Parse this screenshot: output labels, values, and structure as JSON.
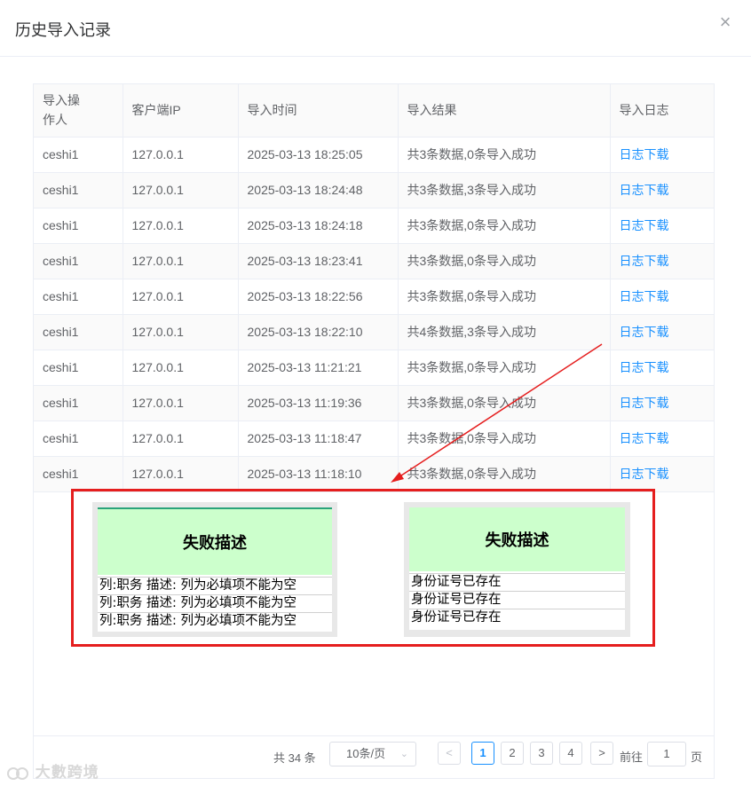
{
  "dialog": {
    "title": "历史导入记录",
    "close_glyph": "×"
  },
  "table": {
    "headers": [
      "导入操作人",
      "客户端IP",
      "导入时间",
      "导入结果",
      "导入日志"
    ],
    "rows": [
      {
        "operator": "ceshi1",
        "ip": "127.0.0.1",
        "time": "2025-03-13 18:25:05",
        "result": "共3条数据,0条导入成功",
        "log": "日志下载"
      },
      {
        "operator": "ceshi1",
        "ip": "127.0.0.1",
        "time": "2025-03-13 18:24:48",
        "result": "共3条数据,3条导入成功",
        "log": "日志下载"
      },
      {
        "operator": "ceshi1",
        "ip": "127.0.0.1",
        "time": "2025-03-13 18:24:18",
        "result": "共3条数据,0条导入成功",
        "log": "日志下载"
      },
      {
        "operator": "ceshi1",
        "ip": "127.0.0.1",
        "time": "2025-03-13 18:23:41",
        "result": "共3条数据,0条导入成功",
        "log": "日志下载"
      },
      {
        "operator": "ceshi1",
        "ip": "127.0.0.1",
        "time": "2025-03-13 18:22:56",
        "result": "共3条数据,0条导入成功",
        "log": "日志下载"
      },
      {
        "operator": "ceshi1",
        "ip": "127.0.0.1",
        "time": "2025-03-13 18:22:10",
        "result": "共4条数据,3条导入成功",
        "log": "日志下载"
      },
      {
        "operator": "ceshi1",
        "ip": "127.0.0.1",
        "time": "2025-03-13 11:21:21",
        "result": "共3条数据,0条导入成功",
        "log": "日志下载"
      },
      {
        "operator": "ceshi1",
        "ip": "127.0.0.1",
        "time": "2025-03-13 11:19:36",
        "result": "共3条数据,0条导入成功",
        "log": "日志下载"
      },
      {
        "operator": "ceshi1",
        "ip": "127.0.0.1",
        "time": "2025-03-13 11:18:47",
        "result": "共3条数据,0条导入成功",
        "log": "日志下载"
      },
      {
        "operator": "ceshi1",
        "ip": "127.0.0.1",
        "time": "2025-03-13 11:18:10",
        "result": "共3条数据,0条导入成功",
        "log": "日志下载"
      }
    ]
  },
  "callout": {
    "left_sheet": {
      "header": "失败描述",
      "rows": [
        "列:职务 描述: 列为必填项不能为空",
        "列:职务 描述: 列为必填项不能为空",
        "列:职务 描述: 列为必填项不能为空"
      ]
    },
    "right_sheet": {
      "header": "失败描述",
      "rows": [
        "身份证号已存在",
        "身份证号已存在",
        "身份证号已存在"
      ]
    },
    "highlight_color": "#e51e1e",
    "header_bg_color": "#ccffcc"
  },
  "pagination": {
    "total_text": "共 34 条",
    "page_size": "10条/页",
    "prev_glyph": "<",
    "next_glyph": ">",
    "pages": [
      "1",
      "2",
      "3",
      "4"
    ],
    "current_page": "1",
    "goto_label": "前往",
    "goto_value": "1",
    "page_suffix": "页"
  },
  "watermark": {
    "text": "大數跨境"
  },
  "colors": {
    "link": "#1890ff",
    "border": "#ebeef5",
    "text": "#606266"
  }
}
